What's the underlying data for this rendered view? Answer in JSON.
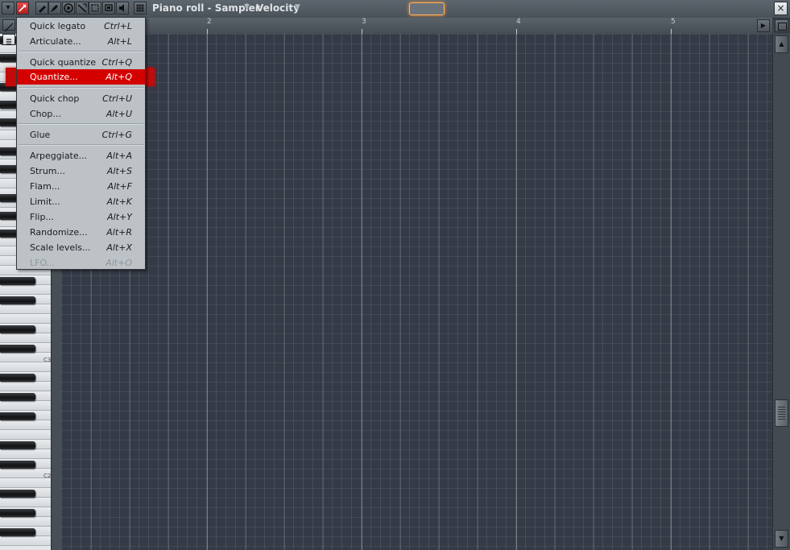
{
  "window": {
    "title": "Piano roll - Sampler",
    "target_label": "Velocity",
    "close_glyph": "×"
  },
  "colors": {
    "menu_highlight": "#d40000",
    "grid_bg": "#353a47",
    "menu_bg": "#bcc2c6"
  },
  "toolbar": {
    "icons": [
      "arrow-down-icon",
      "wrench-icon",
      "pencil-icon",
      "brush-icon",
      "mute-icon",
      "slice-icon",
      "select-icon",
      "zoom-icon",
      "speaker-icon",
      "stamp-icon"
    ]
  },
  "ruler": {
    "bars": [
      "2",
      "3",
      "4",
      "5"
    ]
  },
  "keyboard": {
    "octave_labels": [
      "C3",
      "C2"
    ]
  },
  "tools_menu": {
    "items": [
      {
        "label": "Quick legato",
        "shortcut": "Ctrl+L"
      },
      {
        "label": "Articulate...",
        "shortcut": "Alt+L"
      },
      {
        "label": "Quick quantize",
        "shortcut": "Ctrl+Q"
      },
      {
        "label": "Quantize...",
        "shortcut": "Alt+Q"
      },
      {
        "label": "Quick chop",
        "shortcut": "Ctrl+U"
      },
      {
        "label": "Chop...",
        "shortcut": "Alt+U"
      },
      {
        "label": "Glue",
        "shortcut": "Ctrl+G"
      },
      {
        "label": "Arpeggiate...",
        "shortcut": "Alt+A"
      },
      {
        "label": "Strum...",
        "shortcut": "Alt+S"
      },
      {
        "label": "Flam...",
        "shortcut": "Alt+F"
      },
      {
        "label": "Limit...",
        "shortcut": "Alt+K"
      },
      {
        "label": "Flip...",
        "shortcut": "Alt+Y"
      },
      {
        "label": "Randomize...",
        "shortcut": "Alt+R"
      },
      {
        "label": "Scale levels...",
        "shortcut": "Alt+X"
      },
      {
        "label": "LFO...",
        "shortcut": "Alt+O"
      }
    ],
    "highlighted_index": 3,
    "disabled_index": 14
  }
}
